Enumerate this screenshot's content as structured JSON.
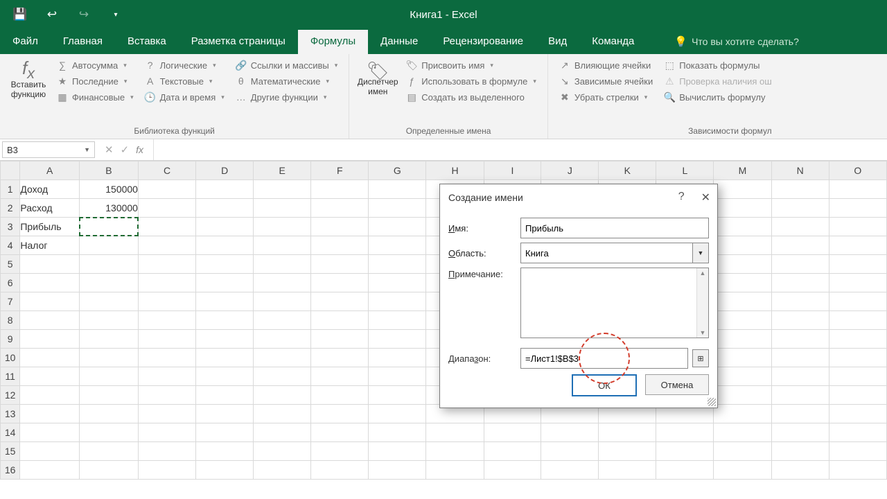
{
  "app": {
    "title": "Книга1 - Excel"
  },
  "qat": {
    "save": "save",
    "undo": "undo",
    "redo": "redo",
    "custom": "customize"
  },
  "tabs": {
    "file": "Файл",
    "home": "Главная",
    "insert": "Вставка",
    "page": "Разметка страницы",
    "formulas": "Формулы",
    "data": "Данные",
    "review": "Рецензирование",
    "view": "Вид",
    "team": "Команда",
    "tellme": "Что вы хотите сделать?"
  },
  "ribbon": {
    "insert_fn": "Вставить функцию",
    "autosum": "Автосумма",
    "recent": "Последние",
    "financial": "Финансовые",
    "logical": "Логические",
    "text": "Текстовые",
    "datetime": "Дата и время",
    "lookup": "Ссылки и массивы",
    "math": "Математические",
    "more": "Другие функции",
    "lib_label": "Библиотека функций",
    "name_mgr": "Диспетчер имен",
    "define": "Присвоить имя",
    "use": "Использовать в формуле",
    "create": "Создать из выделенного",
    "names_label": "Определенные имена",
    "trace_prec": "Влияющие ячейки",
    "trace_dep": "Зависимые ячейки",
    "remove": "Убрать стрелки",
    "show_f": "Показать формулы",
    "err": "Проверка наличия ош",
    "eval": "Вычислить формулу",
    "audit_label": "Зависимости формул"
  },
  "fbar": {
    "name": "B3",
    "fx": "fx"
  },
  "cols": [
    "A",
    "B",
    "C",
    "D",
    "E",
    "F",
    "G",
    "H",
    "I",
    "J",
    "K",
    "L",
    "M",
    "N",
    "O"
  ],
  "rows": {
    "1": {
      "A": "Доход",
      "B": "150000"
    },
    "2": {
      "A": "Расход",
      "B": "130000"
    },
    "3": {
      "A": "Прибыль",
      "B": ""
    },
    "4": {
      "A": "Налог",
      "B": ""
    }
  },
  "dialog": {
    "title": "Создание имени",
    "name_lbl": "Имя:",
    "name_val": "Прибыль",
    "scope_lbl": "Область:",
    "scope_val": "Книга",
    "note_lbl": "Примечание:",
    "range_lbl": "Диапазон:",
    "range_val": "=Лист1!$B$3",
    "ok": "ОК",
    "cancel": "Отмена",
    "help": "?",
    "close": "✕"
  }
}
